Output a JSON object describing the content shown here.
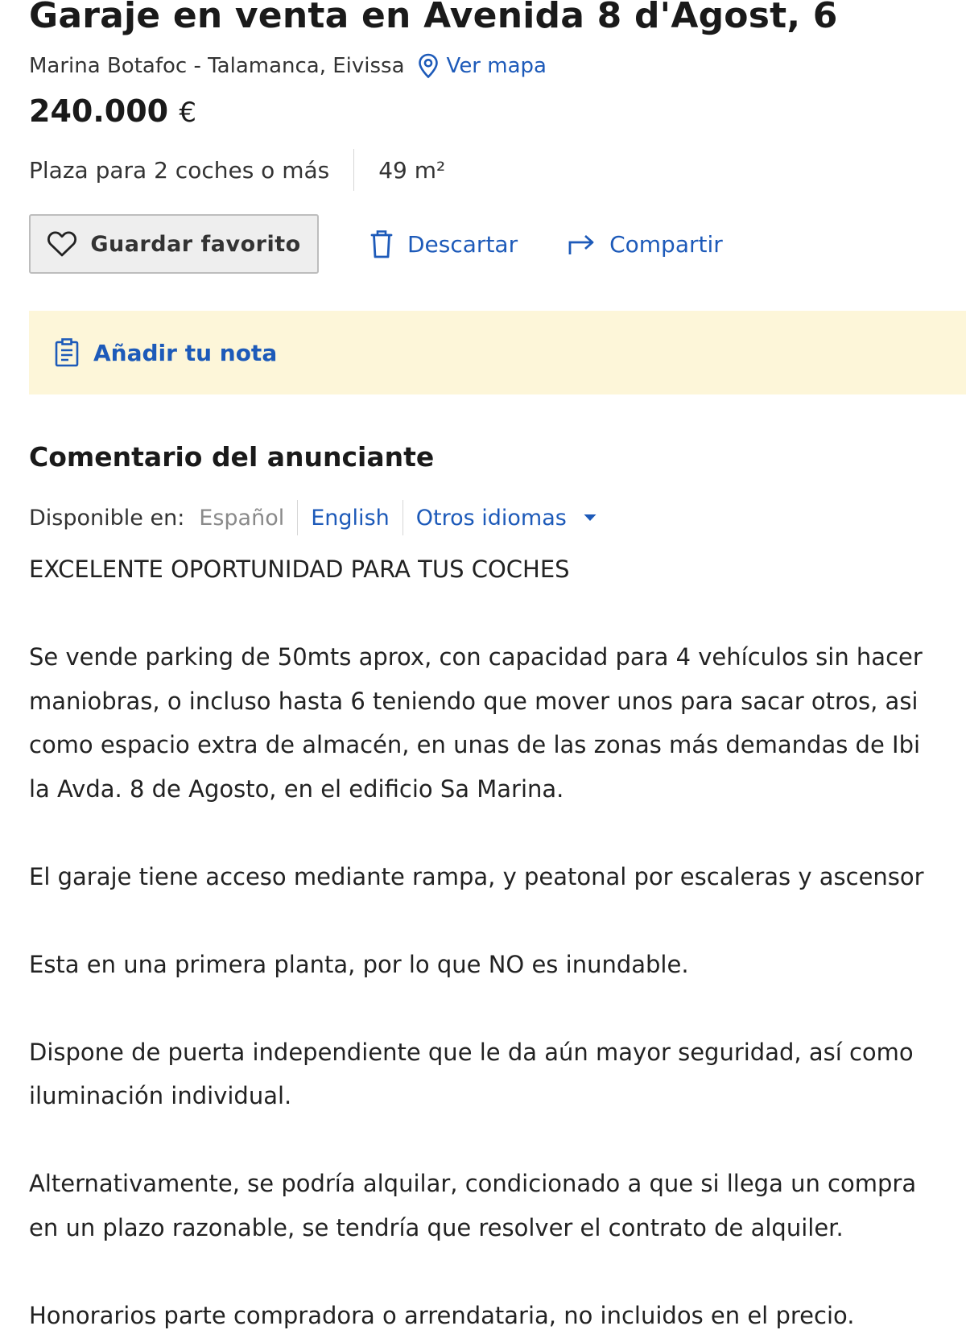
{
  "listing": {
    "title": "Garaje en venta en Avenida 8 d'Agost, 6",
    "location": "Marina Botafoc - Talamanca, Eivissa",
    "map_link": "Ver mapa",
    "price": "240.000",
    "currency": "€",
    "features": [
      "Plaza para 2 coches o más",
      "49 m²"
    ]
  },
  "actions": {
    "favorite": "Guardar favorito",
    "discard": "Descartar",
    "share": "Compartir"
  },
  "note": {
    "label": "Añadir tu nota"
  },
  "comment": {
    "title": "Comentario del anunciante",
    "available_label": "Disponible en:",
    "current_language": "Español",
    "other_language": "English",
    "more_languages": "Otros idiomas",
    "paragraphs": [
      [
        "EXCELENTE OPORTUNIDAD PARA TUS COCHES"
      ],
      [
        "Se vende parking de 50mts aprox, con capacidad para 4 vehículos sin hacer",
        "maniobras, o incluso hasta 6 teniendo que mover unos para sacar otros, asi",
        "como espacio extra de almacén, en unas de las zonas más demandas de Ibi",
        "la Avda. 8 de Agosto, en el edificio Sa Marina."
      ],
      [
        "El garaje tiene acceso mediante rampa, y peatonal por escaleras y ascensor"
      ],
      [
        "Esta en una primera planta, por lo que NO es inundable."
      ],
      [
        "Dispone de puerta independiente que le da aún mayor seguridad, así como",
        "iluminación individual."
      ],
      [
        "Alternativamente, se podría alquilar, condicionado a que si llega un compra",
        "en un plazo razonable, se tendría que resolver el contrato de alquiler."
      ],
      [
        "Honorarios parte compradora o arrendataria, no incluidos en el precio."
      ]
    ]
  },
  "colors": {
    "link": "#1d5ab9",
    "note_background": "#fdf6d9",
    "button_background": "#eeeeee"
  },
  "icons": [
    "map-pin-icon",
    "heart-icon",
    "trash-icon",
    "share-arrow-icon",
    "note-icon",
    "caret-down-icon"
  ]
}
